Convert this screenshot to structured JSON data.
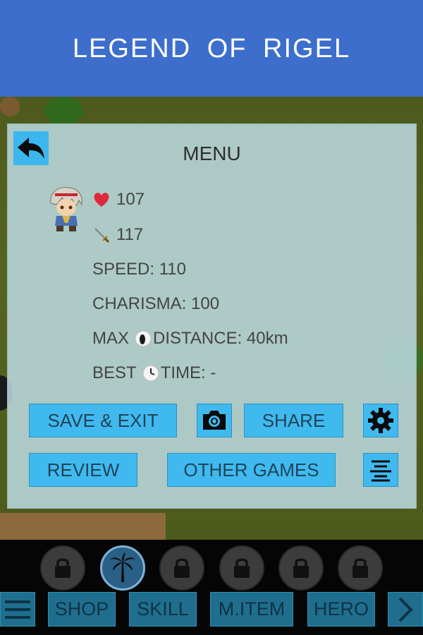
{
  "header": {
    "title": "LEGEND  OF  RIGEL"
  },
  "menu": {
    "title": "MENU",
    "stats": {
      "hp": "107",
      "attack": "117",
      "speed": "SPEED: 110",
      "charisma": "CHARISMA: 100",
      "max_distance_prefix": "MAX",
      "max_distance_suffix": "DISTANCE: 40km",
      "best_time_prefix": "BEST",
      "best_time_suffix": "TIME: -"
    },
    "buttons": {
      "save_exit": "SAVE & EXIT",
      "share": "SHARE",
      "review": "REVIEW",
      "other_games": "OTHER GAMES"
    }
  },
  "bottom_nav": {
    "shop": "SHOP",
    "skill": "SKILL",
    "m_item": "M.ITEM",
    "hero": "HERO"
  },
  "icons": {
    "back": "back-arrow-icon",
    "heart": "heart-icon",
    "sword": "sword-icon",
    "footprint": "footprint-icon",
    "clock": "clock-icon",
    "camera": "camera-icon",
    "settings": "gear-icon",
    "list": "list-settings-icon",
    "lock": "lock-icon",
    "palm": "palm-tree-icon",
    "menu": "hamburger-icon",
    "next": "chevron-right-icon"
  },
  "colors": {
    "header_bg": "#3d6ecb",
    "button_bg": "#40b9ef",
    "panel_bg": "#bad8de",
    "heart": "#e0283c"
  }
}
